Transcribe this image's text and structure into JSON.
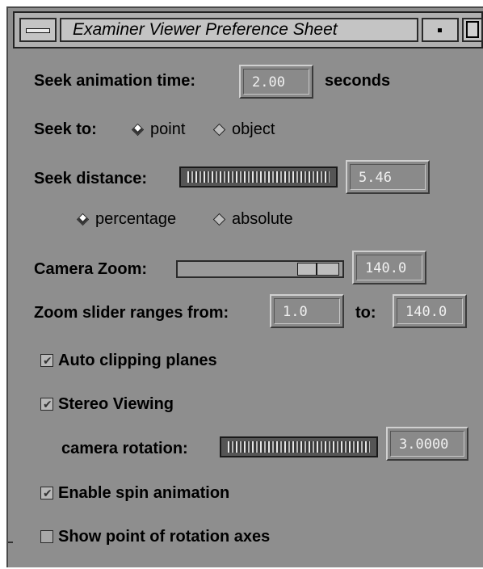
{
  "window": {
    "title": "Examiner Viewer Preference Sheet"
  },
  "seek_animation": {
    "label": "Seek animation time:",
    "value": "2.00",
    "unit": "seconds"
  },
  "seek_to": {
    "label": "Seek to:",
    "options": [
      "point",
      "object"
    ],
    "selected": "point"
  },
  "seek_distance": {
    "label": "Seek distance:",
    "value": "5.46",
    "modes": [
      "percentage",
      "absolute"
    ],
    "selected_mode": "percentage"
  },
  "camera_zoom": {
    "label": "Camera Zoom:",
    "value": "140.0",
    "slider_level": 1.0
  },
  "zoom_range": {
    "label": "Zoom slider ranges from:",
    "from": "1.0",
    "to_label": "to:",
    "to": "140.0"
  },
  "auto_clipping": {
    "label": "Auto clipping planes",
    "checked": true
  },
  "stereo": {
    "label": "Stereo Viewing",
    "checked": true,
    "rotation_label": "camera rotation:",
    "rotation_value": "3.0000"
  },
  "spin_animation": {
    "label": "Enable spin animation",
    "checked": true
  },
  "rotation_axes": {
    "label": "Show point of rotation axes",
    "checked": false
  },
  "colors": {
    "panel": "#8e8e8e",
    "field_text": "#f0f0f0"
  }
}
